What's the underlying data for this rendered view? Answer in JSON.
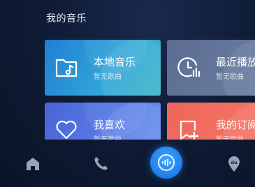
{
  "header": {
    "title": "我的音乐"
  },
  "cards": [
    {
      "label": "本地音乐",
      "sub": "暂无歌曲",
      "icon": "music-folder-icon"
    },
    {
      "label": "最近播放",
      "sub": "暂无歌曲",
      "icon": "recent-clock-icon"
    },
    {
      "label": "我喜欢",
      "sub": "暂无歌曲",
      "icon": "heart-icon"
    },
    {
      "label": "我的订阅",
      "sub": "暂无歌曲",
      "icon": "bookmark-add-icon"
    }
  ],
  "nav": {
    "items": [
      {
        "icon": "home-icon"
      },
      {
        "icon": "phone-icon"
      },
      {
        "icon": "voice-assistant-icon"
      },
      {
        "icon": "du-location-icon",
        "badge": "du"
      }
    ]
  },
  "colors": {
    "background": "#0e1a33",
    "card_local": "#2b96d6",
    "card_recent": "#64779b",
    "card_favorite": "#5576e0",
    "card_subscribe": "#f2705f",
    "voice_button": "#1f7fe8"
  }
}
